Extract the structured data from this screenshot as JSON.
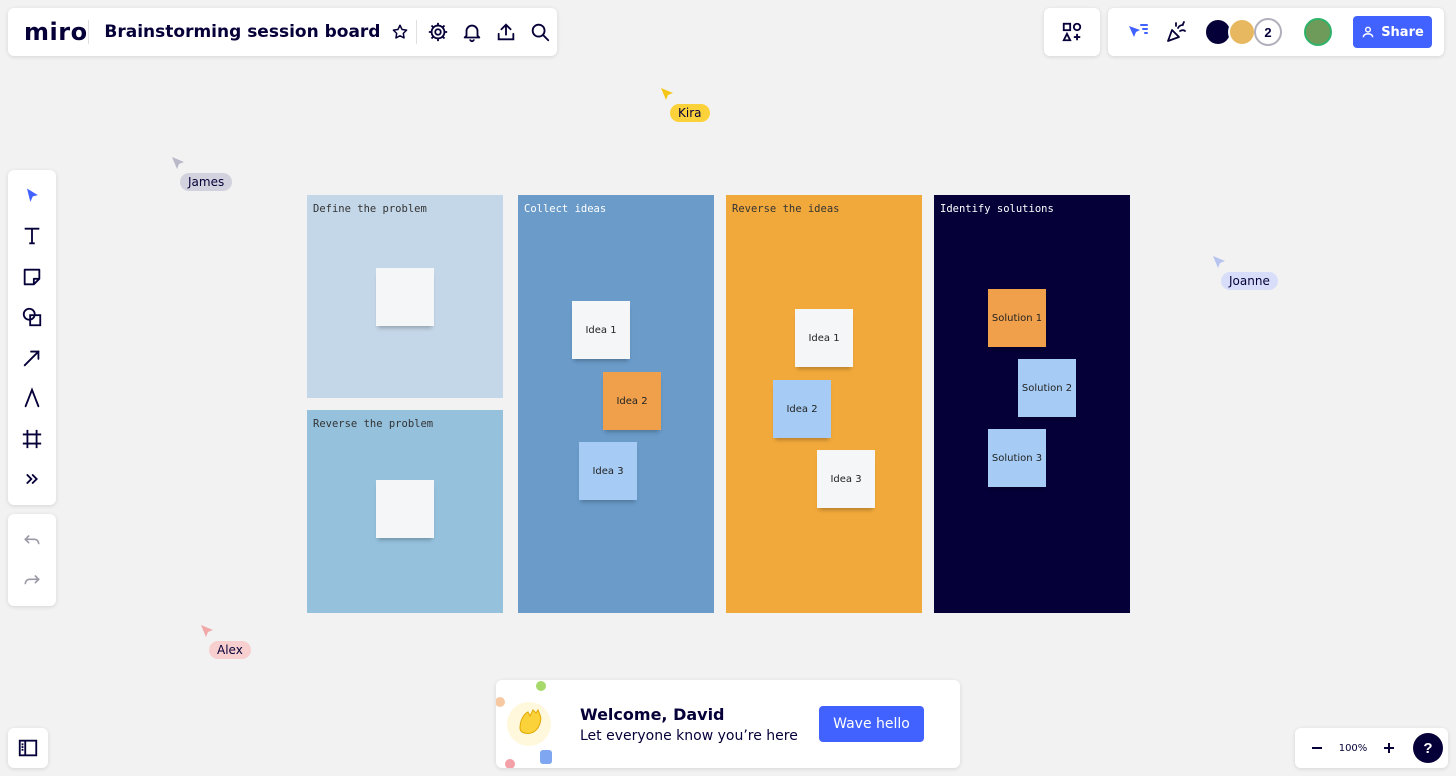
{
  "app": {
    "logo": "miro",
    "board_title": "Brainstorming session board"
  },
  "top_right": {
    "collaborator_count": "2",
    "share_label": "Share"
  },
  "cursors": [
    {
      "name": "Kira",
      "color": "#f5c518",
      "label_bg": "#fcd23a"
    },
    {
      "name": "James",
      "color": "#b8b8c8",
      "label_bg": "#d2d2de"
    },
    {
      "name": "Joanne",
      "color": "#b8c4f0",
      "label_bg": "#d8defa"
    },
    {
      "name": "Alex",
      "color": "#f0a8a8",
      "label_bg": "#f8cfcf"
    }
  ],
  "frames": {
    "define": {
      "title": "Define the problem",
      "bg": "#c4d7e8"
    },
    "reverse_problem": {
      "title": "Reverse the problem",
      "bg": "#95c1dd"
    },
    "collect": {
      "title": "Collect ideas",
      "bg": "#6a9bc9",
      "stickies": [
        "Idea 1",
        "Idea 2",
        "Idea 3"
      ]
    },
    "reverse_ideas": {
      "title": "Reverse the ideas",
      "bg": "#f2a93b",
      "stickies": [
        "Idea 1",
        "Idea 2",
        "Idea 3"
      ]
    },
    "solutions": {
      "title": "Identify solutions",
      "bg": "#050038",
      "stickies": [
        "Solution 1",
        "Solution 2",
        "Solution 3"
      ]
    }
  },
  "sticky_colors": {
    "white": "#f5f6f8",
    "orange": "#f0a04b",
    "blue": "#a6ccf5"
  },
  "welcome": {
    "title": "Welcome, David",
    "subtitle": "Let everyone know you’re here",
    "button": "Wave hello"
  },
  "zoom": {
    "level": "100%"
  },
  "help": {
    "label": "?"
  },
  "colors": {
    "accent": "#4262ff",
    "text": "#050038"
  }
}
